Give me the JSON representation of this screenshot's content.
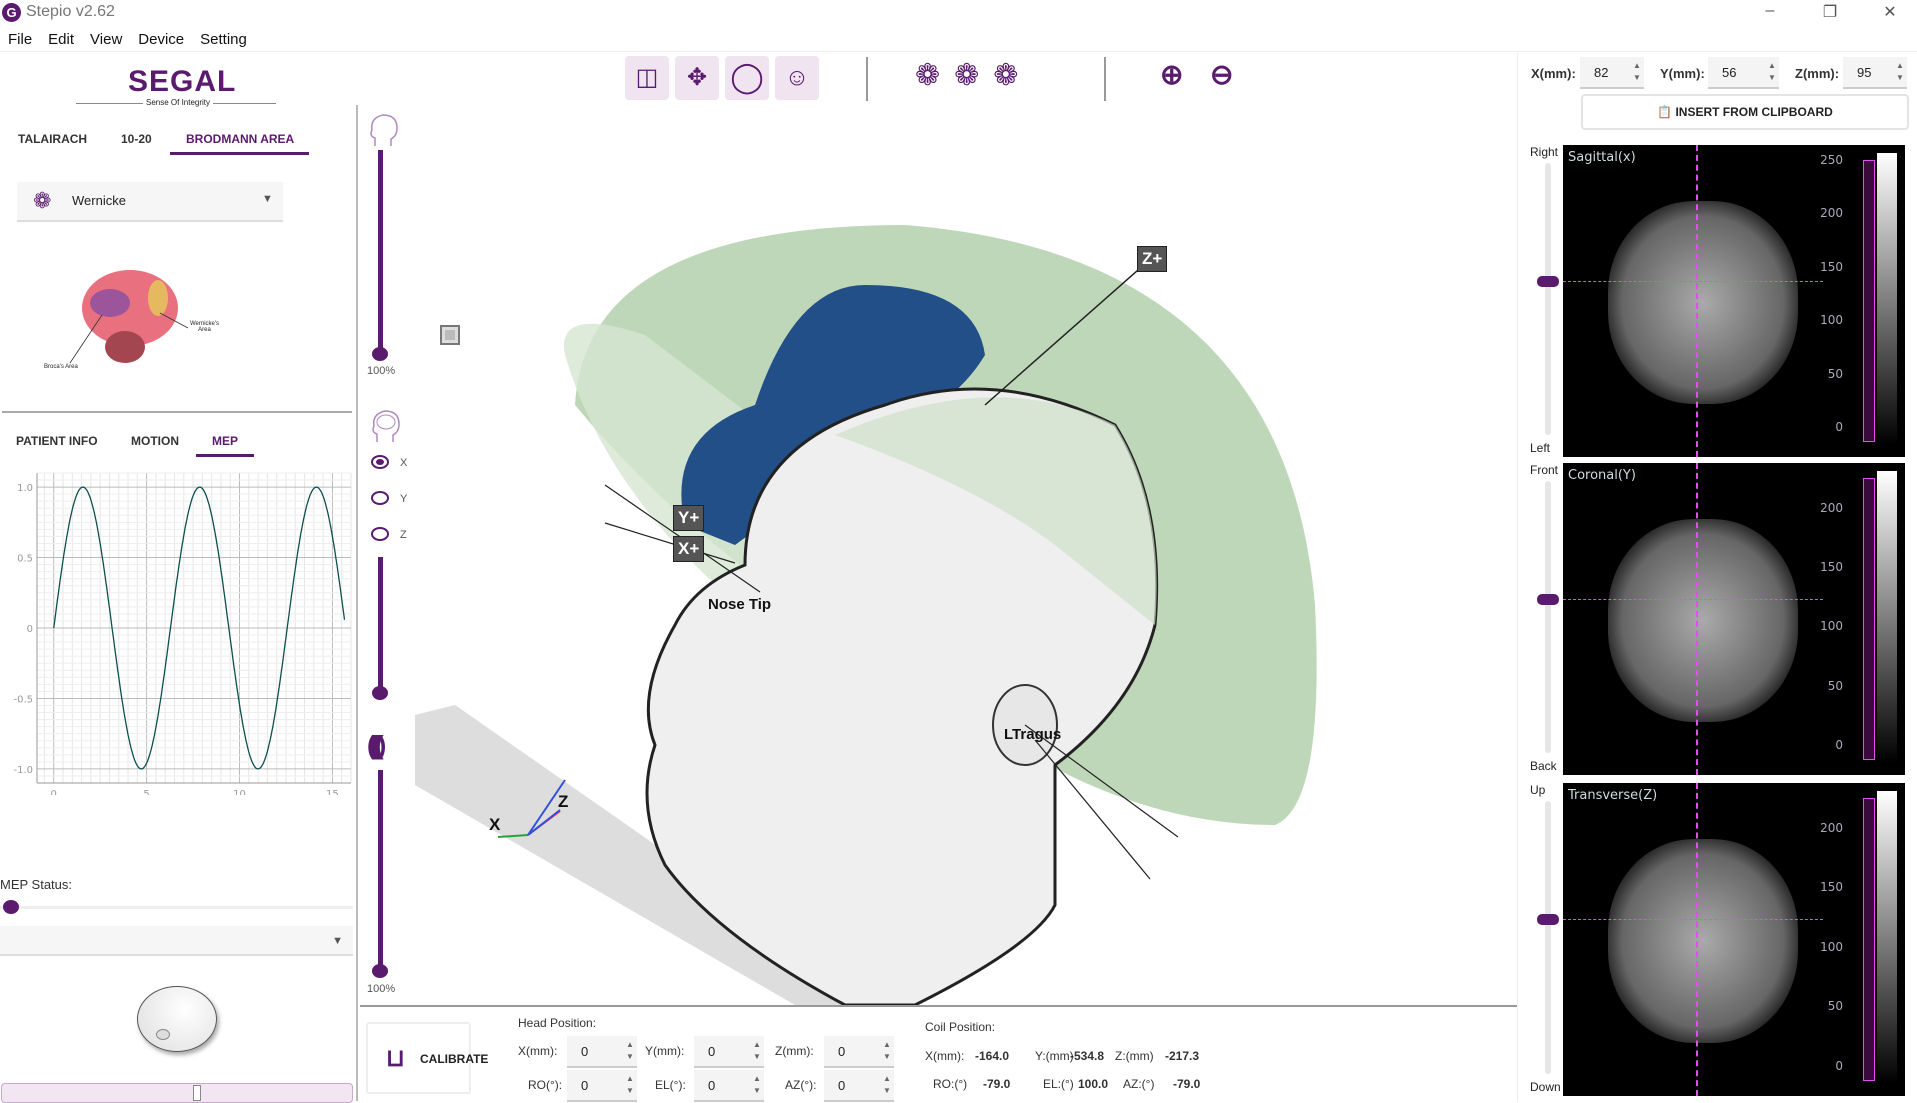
{
  "window": {
    "title": "Stepio v2.62",
    "controls": [
      "minimize",
      "restore",
      "close"
    ]
  },
  "menu": [
    "File",
    "Edit",
    "View",
    "Device",
    "Setting"
  ],
  "logo": {
    "text": "SEGAL",
    "tagline": "Sense Of Integrity"
  },
  "atlas_tabs": [
    {
      "label": "TALAIRACH",
      "active": false
    },
    {
      "label": "10-20",
      "active": false
    },
    {
      "label": "BRODMANN AREA",
      "active": true
    }
  ],
  "area_select": {
    "value": "Wernicke",
    "icon": "brain-icon"
  },
  "area_image": {
    "labels": [
      "Wernicke's Area",
      "Broca's Area"
    ]
  },
  "info_tabs": [
    {
      "label": "PATIENT INFO",
      "active": false
    },
    {
      "label": "MOTION",
      "active": false
    },
    {
      "label": "MEP",
      "active": true
    }
  ],
  "chart_data": {
    "type": "line",
    "title": "",
    "xlabel": "",
    "ylabel": "",
    "xlim": [
      -0.9,
      16
    ],
    "ylim": [
      -1.1,
      1.1
    ],
    "xticks": [
      "0",
      "5",
      "10",
      "15"
    ],
    "yticks": [
      "1.0",
      "0.5",
      "0",
      "-0.5",
      "-1.0"
    ],
    "grid": true,
    "series": [
      {
        "function": "sin(x)",
        "x_range": [
          0,
          15.7
        ],
        "color": "#0d4f4f"
      }
    ]
  },
  "mep": {
    "status_label": "MEP Status:",
    "slider_value": 0,
    "select_value": ""
  },
  "toolbar": {
    "groups": [
      [
        "calibration-icon",
        "move-axes-icon",
        "sphere-icon",
        "head-brain-icon"
      ],
      [
        "brain-side-icon",
        "brain-top-icon",
        "brain-split-icon"
      ],
      [
        "zoom-in-icon",
        "zoom-out-icon"
      ]
    ],
    "accent": "#5a1a6e"
  },
  "side_controls": {
    "head_opacity": "100%",
    "radio": [
      {
        "label": "X",
        "checked": true
      },
      {
        "label": "Y",
        "checked": false
      },
      {
        "label": "Z",
        "checked": false
      }
    ],
    "coil_opacity": "100%"
  },
  "scene": {
    "labels": {
      "z_plus": "Z+",
      "y_plus": "Y+",
      "x_plus": "X+",
      "nose": "Nose Tip",
      "tragus": "LTragus",
      "axis_x": "X",
      "axis_z": "Z"
    }
  },
  "bottom": {
    "calibrate": "CALIBRATE",
    "head_title": "Head Position:",
    "head": [
      {
        "label": "X(mm):",
        "value": "0"
      },
      {
        "label": "Y(mm):",
        "value": "0"
      },
      {
        "label": "Z(mm):",
        "value": "0"
      },
      {
        "label": "RO(°):",
        "value": "0"
      },
      {
        "label": "EL(°):",
        "value": "0"
      },
      {
        "label": "AZ(°):",
        "value": "0"
      }
    ],
    "coil_title": "Coil Position:",
    "coil": [
      {
        "label": "X(mm):",
        "value": "-164.0"
      },
      {
        "label": "Y:(mm)",
        "value": "-534.8"
      },
      {
        "label": "Z:(mm)",
        "value": "-217.3"
      },
      {
        "label": "RO:(°)",
        "value": "-79.0"
      },
      {
        "label": "EL:(°)",
        "value": "100.0"
      },
      {
        "label": "AZ:(°)",
        "value": "-79.0"
      }
    ]
  },
  "target": {
    "x_label": "X(mm):",
    "x": "82",
    "y_label": "Y(mm):",
    "y": "56",
    "z_label": "Z(mm):",
    "z": "95",
    "insert": "INSERT FROM CLIPBOARD"
  },
  "views": [
    {
      "title": "Sagittal(x)",
      "top": "Right",
      "bottom": "Left",
      "ticks": [
        "250",
        "200",
        "150",
        "100",
        "50",
        "0"
      ]
    },
    {
      "title": "Coronal(Y)",
      "top": "Front",
      "bottom": "Back",
      "ticks": [
        "200",
        "150",
        "100",
        "50",
        "0"
      ]
    },
    {
      "title": "Transverse(Z)",
      "top": "Up",
      "bottom": "Down",
      "ticks": [
        "200",
        "150",
        "100",
        "50",
        "0"
      ]
    }
  ]
}
